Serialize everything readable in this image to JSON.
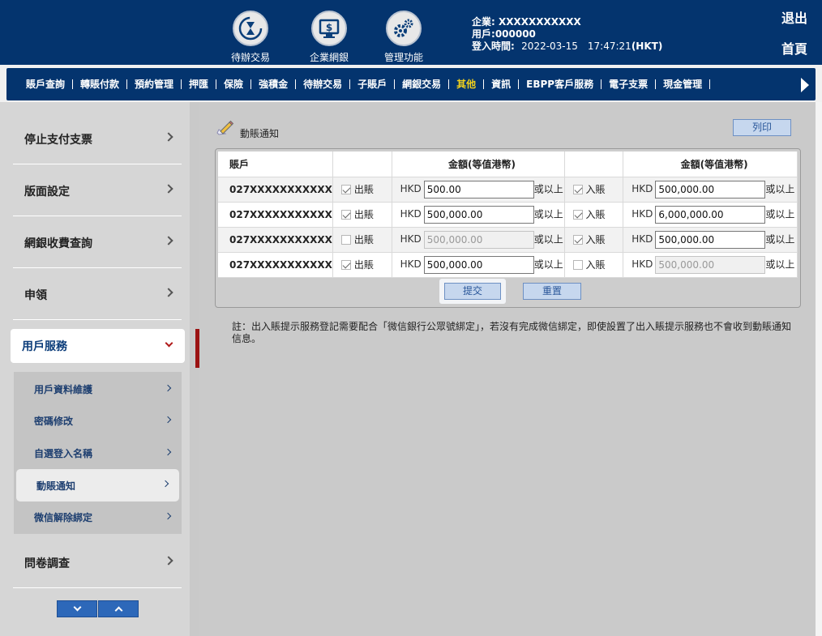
{
  "header": {
    "icons": [
      {
        "label": "待辦交易",
        "icon": "hourglass-refresh-icon"
      },
      {
        "label": "企業網銀",
        "icon": "monitor-dollar-icon"
      },
      {
        "label": "管理功能",
        "icon": "gears-icon"
      }
    ],
    "company_label": "企業:",
    "company_value": "XXXXXXXXXXX",
    "user_label": "用戶:",
    "user_value": "000000",
    "login_label": "登入時間:",
    "login_value": "2022-03-15　17:47:21",
    "login_tz": "(HKT)",
    "logout": "退出",
    "home": "首頁"
  },
  "nav": {
    "items": [
      "賬戶查詢",
      "轉賬付款",
      "預約管理",
      "押匯",
      "保險",
      "強積金",
      "待辦交易",
      "子賬戶",
      "網銀交易",
      "其他",
      "資訊",
      "EBPP客戶服務",
      "電子支票",
      "現金管理"
    ],
    "active": "其他"
  },
  "sidebar": {
    "items": [
      "停止支付支票",
      "版面設定",
      "網銀收費查詢",
      "申領",
      "用戶服務",
      "問卷調查"
    ],
    "expanded": "用戶服務",
    "submenu": [
      "用戶資料維護",
      "密碼修改",
      "自選登入名稱",
      "動賬通知",
      "微信解除綁定"
    ],
    "active_sub": "動賬通知"
  },
  "page": {
    "title": "動賬通知",
    "print": "列印",
    "submit": "提交",
    "reset": "重置",
    "note": "註：出入賬提示服務登記需要配合「微信銀行公眾號綁定」，若沒有完成微信綁定，即使設置了出入賬提示服務也不會收到動賬通知信息。"
  },
  "table": {
    "headers": {
      "account": "賬戶",
      "amount_out": "金額(等值港幣)",
      "amount_in": "金額(等值港幣)"
    },
    "out_label": "出賬",
    "in_label": "入賬",
    "currency": "HKD",
    "suffix": "或以上",
    "rows": [
      {
        "account": "027XXXXXXXXXXX",
        "out_checked": true,
        "out_amount": "500.00",
        "in_checked": true,
        "in_amount": "500,000.00"
      },
      {
        "account": "027XXXXXXXXXXX",
        "out_checked": true,
        "out_amount": "500,000.00",
        "in_checked": true,
        "in_amount": "6,000,000.00"
      },
      {
        "account": "027XXXXXXXXXXX",
        "out_checked": false,
        "out_amount": "500,000.00",
        "in_checked": true,
        "in_amount": "500,000.00"
      },
      {
        "account": "027XXXXXXXXXXX",
        "out_checked": true,
        "out_amount": "500,000.00",
        "in_checked": false,
        "in_amount": "500,000.00"
      }
    ]
  }
}
